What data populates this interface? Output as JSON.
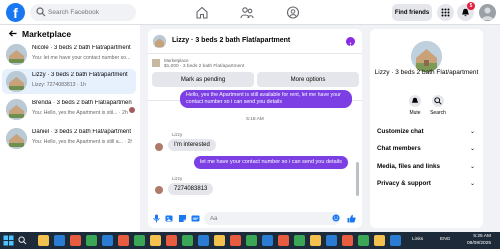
{
  "topbar": {
    "logo_letter": "f",
    "search_placeholder": "Search Facebook",
    "find_friends": "Find friends",
    "notifications_count": "5"
  },
  "sidebar": {
    "title": "Marketplace",
    "conversations": [
      {
        "title": "Nicole · 3 beds 2 bath Flat/apartment",
        "preview": "You: let me have your contact number so...",
        "active": false
      },
      {
        "title": "Lizzy · 3 beds 2 bath Flat/apartment",
        "preview": "Lizzy: 7274083813 · 1h",
        "active": true
      },
      {
        "title": "Brenda · 3 beds 2 bath Flat/apartment",
        "preview": "You: Hello, yes the Apartment is stil...  · 2h",
        "active": false
      },
      {
        "title": "Daniel · 3 beds 2 bath Flat/apartment",
        "preview": "You: Hello, yes the Apartment is still a...  · 2h",
        "active": false
      }
    ]
  },
  "chat": {
    "title": "Lizzy · 3 beds 2 bath Flat/apartment",
    "listing_label": "Marketplace",
    "listing_price": "$1,000 · 3 beds 2 bath Flat/apartment",
    "mark_pending": "Mark as pending",
    "more_options": "More options",
    "msg_out_1": "Hello, yes the Apartment is still available for rent, let me have your contact number so i can send you details",
    "timestamp": "5:18 AM",
    "sender_1": "Lizzy",
    "msg_in_1": "I'm interested",
    "msg_out_2": "let me have your contact number so i can send you details",
    "sender_2": "Lizzy",
    "msg_in_2": "7274083813",
    "composer_placeholder": "Aa"
  },
  "details": {
    "title": "Lizzy · 3 beds 2 bath Flat/apartment",
    "mute": "Mute",
    "search": "Search",
    "rows": [
      "Customize chat",
      "Chat members",
      "Media, files and links",
      "Privacy & support"
    ]
  },
  "taskbar": {
    "weather": "Links",
    "lang": "ENG",
    "time": "5:25 AM",
    "date": "08/08/2025"
  },
  "colors": {
    "brand": "#1877f2",
    "outgoing_bubble": "#7b3fe4",
    "incoming_bubble": "#e4e6eb"
  }
}
